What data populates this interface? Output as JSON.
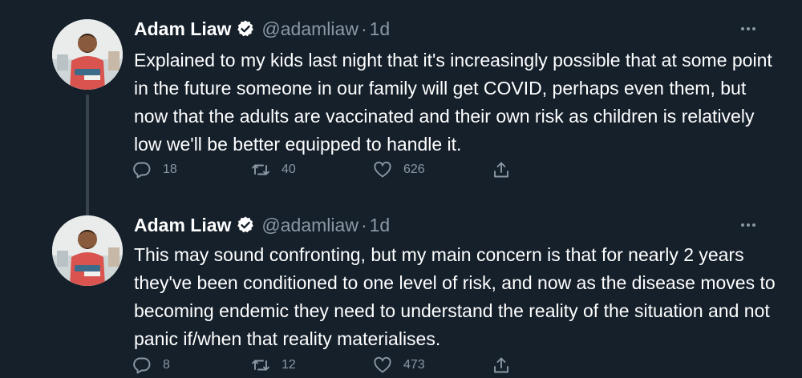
{
  "tweets": [
    {
      "author_name": "Adam Liaw",
      "handle": "@adamliaw",
      "separator": "·",
      "time": "1d",
      "text": "Explained to my kids last night that it's increasingly possible that at some point in the future someone in our family will get COVID, perhaps even them, but now that the adults are vaccinated and their own risk as children is relatively low we'll be better equipped to handle it.",
      "replies": "18",
      "retweets": "40",
      "likes": "626"
    },
    {
      "author_name": "Adam Liaw",
      "handle": "@adamliaw",
      "separator": "·",
      "time": "1d",
      "text": "This may sound confronting, but my main concern is that for nearly 2 years they've been conditioned to one level of risk, and now as the disease moves to becoming endemic they need to understand the reality of the situation and not panic if/when that reality materialises.",
      "replies": "8",
      "retweets": "12",
      "likes": "473"
    }
  ],
  "colors": {
    "background": "#15202b",
    "text_primary": "#ffffff",
    "text_secondary": "#8b98a5",
    "verified_badge": "#ffffff",
    "thread_line": "#38444d"
  },
  "icons": {
    "verified": "verified-badge-icon",
    "more": "more-options-icon",
    "reply": "reply-icon",
    "retweet": "retweet-icon",
    "like": "like-heart-icon",
    "share": "share-icon"
  }
}
